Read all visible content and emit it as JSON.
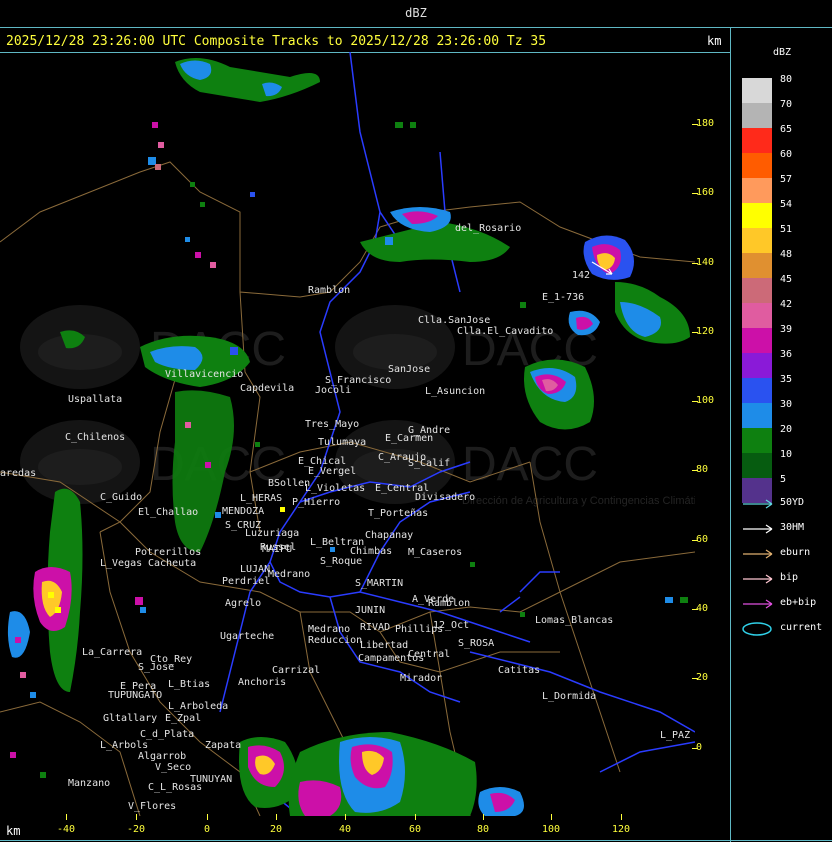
{
  "title": "dBZ",
  "header": "2025/12/28 23:26:00 UTC Composite Tracks to 2025/12/28 23:26:00 Tz 35",
  "axis_unit_top": "km",
  "axis_unit_bottom": "km",
  "y_ticks": [
    "180",
    "160",
    "140",
    "120",
    "100",
    "80",
    "60",
    "40",
    "20",
    "0"
  ],
  "x_ticks": [
    "-40",
    "-20",
    "0",
    "20",
    "40",
    "60",
    "80",
    "100",
    "120"
  ],
  "legend": {
    "title": "dBZ",
    "levels": [
      {
        "label": "80",
        "color": "#d8d8d8"
      },
      {
        "label": "70",
        "color": "#b4b4b4"
      },
      {
        "label": "65",
        "color": "#ff2a1a"
      },
      {
        "label": "60",
        "color": "#ff5c00"
      },
      {
        "label": "57",
        "color": "#ff9a5c"
      },
      {
        "label": "54",
        "color": "#ffff00"
      },
      {
        "label": "51",
        "color": "#ffc828"
      },
      {
        "label": "48",
        "color": "#e09030"
      },
      {
        "label": "45",
        "color": "#cc6a78"
      },
      {
        "label": "42",
        "color": "#e05ca0"
      },
      {
        "label": "39",
        "color": "#cc10a8"
      },
      {
        "label": "36",
        "color": "#8a1ad8"
      },
      {
        "label": "35",
        "color": "#2a52f0"
      },
      {
        "label": "30",
        "color": "#1e8ce8"
      },
      {
        "label": "20",
        "color": "#0e8010"
      },
      {
        "label": "10",
        "color": "#065c10"
      },
      {
        "label": "5",
        "color": "#54328c"
      }
    ],
    "tracks": [
      {
        "label": "50YD",
        "color": "#5fd7e0"
      },
      {
        "label": "30HM",
        "color": "#ffffff"
      },
      {
        "label": "eburn",
        "color": "#e0b070"
      },
      {
        "label": "bip",
        "color": "#ffc8d2"
      },
      {
        "label": "eb+bip",
        "color": "#e050e0"
      },
      {
        "label": "current",
        "color": "#30d0e8"
      }
    ]
  },
  "watermark": {
    "text": "DACC",
    "subtitle": "Dirección de Agricultura y Contingencias Climáticas"
  },
  "places": [
    "Ramblon",
    "del_Rosario",
    "Clla.SanJose",
    "Clla.El_Cavadito",
    "E_1-736",
    "142",
    "Villavicencio",
    "Capdevila",
    "S_Francisco",
    "SanJose",
    "L_Asuncion",
    "Jocoli",
    "Uspallata",
    "Tres_Mayo",
    "Tulumaya",
    "G_Andre",
    "E_Carmen",
    "C_Chilenos",
    "C_Araujo",
    "S_Calif",
    "E_Chical",
    "E_Vergel",
    "BSollen",
    "L_Violetas",
    "E_Central",
    "Divisadero",
    "L_HERAS",
    "P_Hierro",
    "C_Guido",
    "El_Challao",
    "MENDOZA",
    "T_Porteñas",
    "S_CRUZ",
    "Luzuriaga",
    "Chapanay",
    "L_Beltran",
    "Russel",
    "Chimbas",
    "M_Caseros",
    "Potrerillos",
    "MAIPU",
    "S_Roque",
    "L_Vegas",
    "Cacheuta",
    "LUJAN",
    "Medrano",
    "S_MARTIN",
    "Perdriel",
    "A_Verde",
    "Ramblon",
    "Agrelo",
    "JUNIN",
    "Ugarteche",
    "Medrano",
    "RIVAD",
    "Phillips",
    "12_Oct",
    "Lomas_Blancas",
    "Reduccion",
    "Libertad",
    "S_ROSA",
    "La_Carrera",
    "Cto_Rey",
    "Campamentos",
    "Central",
    "Catitas",
    "S_Jose",
    "Carrizal",
    "E_Pera",
    "L_Btias",
    "Anchoris",
    "TUPUNGATO",
    "Mirador",
    "L_Dormida",
    "L_Arboleda",
    "Gltallary",
    "E_Zpal",
    "L_PAZ",
    "C_d_Plata",
    "L_Arbols",
    "Zapata",
    "Algarrob",
    "Manzano",
    "V_Seco",
    "TUNUYAN",
    "C_L_Rosas",
    "V_Flores",
    "aredas"
  ]
}
